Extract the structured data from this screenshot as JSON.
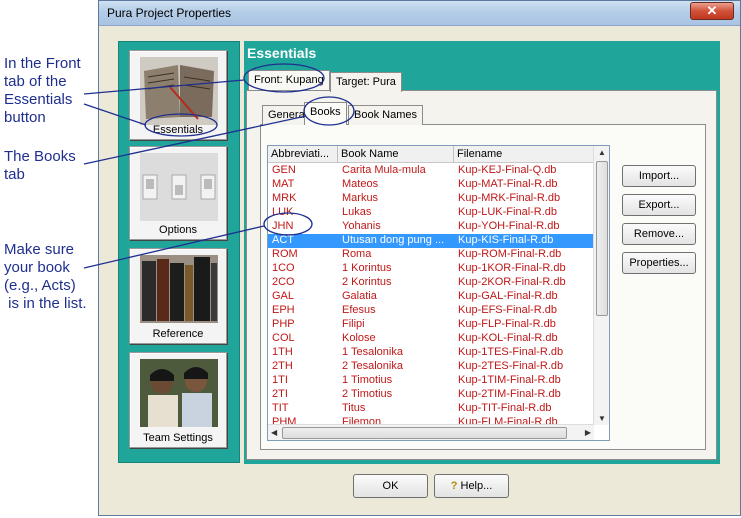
{
  "annotations": {
    "front_tab_note": "In the Front\ntab of the\nEssentials\nbutton",
    "books_tab_note": "The Books\ntab",
    "book_list_note": "Make sure\nyour book\n(e.g., Acts)\n is in the list."
  },
  "window": {
    "title": "Pura Project Properties",
    "close_label": "✕"
  },
  "nav": {
    "essentials_label": "Essentials",
    "options_label": "Options",
    "reference_label": "Reference",
    "team_label": "Team Settings"
  },
  "section": {
    "title": "Essentials"
  },
  "outer_tabs": {
    "front": "Front: Kupang",
    "target": "Target: Pura"
  },
  "inner_tabs": {
    "general": "General",
    "books": "Books",
    "book_names": "Book Names"
  },
  "book_list": {
    "headers": [
      "Abbreviati...",
      "Book Name",
      "Filename"
    ],
    "rows": [
      {
        "abbr": "GEN",
        "name": "Carita Mula-mula",
        "file": "Kup-KEJ-Final-Q.db"
      },
      {
        "abbr": "MAT",
        "name": "Mateos",
        "file": "Kup-MAT-Final-R.db"
      },
      {
        "abbr": "MRK",
        "name": "Markus",
        "file": "Kup-MRK-Final-R.db"
      },
      {
        "abbr": "LUK",
        "name": "Lukas",
        "file": "Kup-LUK-Final-R.db"
      },
      {
        "abbr": "JHN",
        "name": "Yohanis",
        "file": "Kup-YOH-Final-R.db"
      },
      {
        "abbr": "ACT",
        "name": "Utusan dong pung ...",
        "file": "Kup-KIS-Final-R.db"
      },
      {
        "abbr": "ROM",
        "name": "Roma",
        "file": "Kup-ROM-Final-R.db"
      },
      {
        "abbr": "1CO",
        "name": "1 Korintus",
        "file": "Kup-1KOR-Final-R.db"
      },
      {
        "abbr": "2CO",
        "name": "2 Korintus",
        "file": "Kup-2KOR-Final-R.db"
      },
      {
        "abbr": "GAL",
        "name": "Galatia",
        "file": "Kup-GAL-Final-R.db"
      },
      {
        "abbr": "EPH",
        "name": "Efesus",
        "file": "Kup-EFS-Final-R.db"
      },
      {
        "abbr": "PHP",
        "name": "Filipi",
        "file": "Kup-FLP-Final-R.db"
      },
      {
        "abbr": "COL",
        "name": "Kolose",
        "file": "Kup-KOL-Final-R.db"
      },
      {
        "abbr": "1TH",
        "name": "1 Tesalonika",
        "file": "Kup-1TES-Final-R.db"
      },
      {
        "abbr": "2TH",
        "name": "2 Tesalonika",
        "file": "Kup-2TES-Final-R.db"
      },
      {
        "abbr": "1TI",
        "name": "1 Timotius",
        "file": "Kup-1TIM-Final-R.db"
      },
      {
        "abbr": "2TI",
        "name": "2 Timotius",
        "file": "Kup-2TIM-Final-R.db"
      },
      {
        "abbr": "TIT",
        "name": "Titus",
        "file": "Kup-TIT-Final-R.db"
      },
      {
        "abbr": "PHM",
        "name": "Filemon",
        "file": "Kup-FLM-Final-R.db"
      }
    ],
    "selected_abbr": "ACT",
    "selection_color": "#3399ff",
    "row_text_color": "#c01818"
  },
  "side_buttons": {
    "import": "Import...",
    "export": "Export...",
    "remove": "Remove...",
    "properties": "Properties..."
  },
  "footer": {
    "ok": "OK",
    "help": "Help..."
  },
  "colors": {
    "teal": "#1fa59a",
    "annotation": "#1f2f8f"
  }
}
